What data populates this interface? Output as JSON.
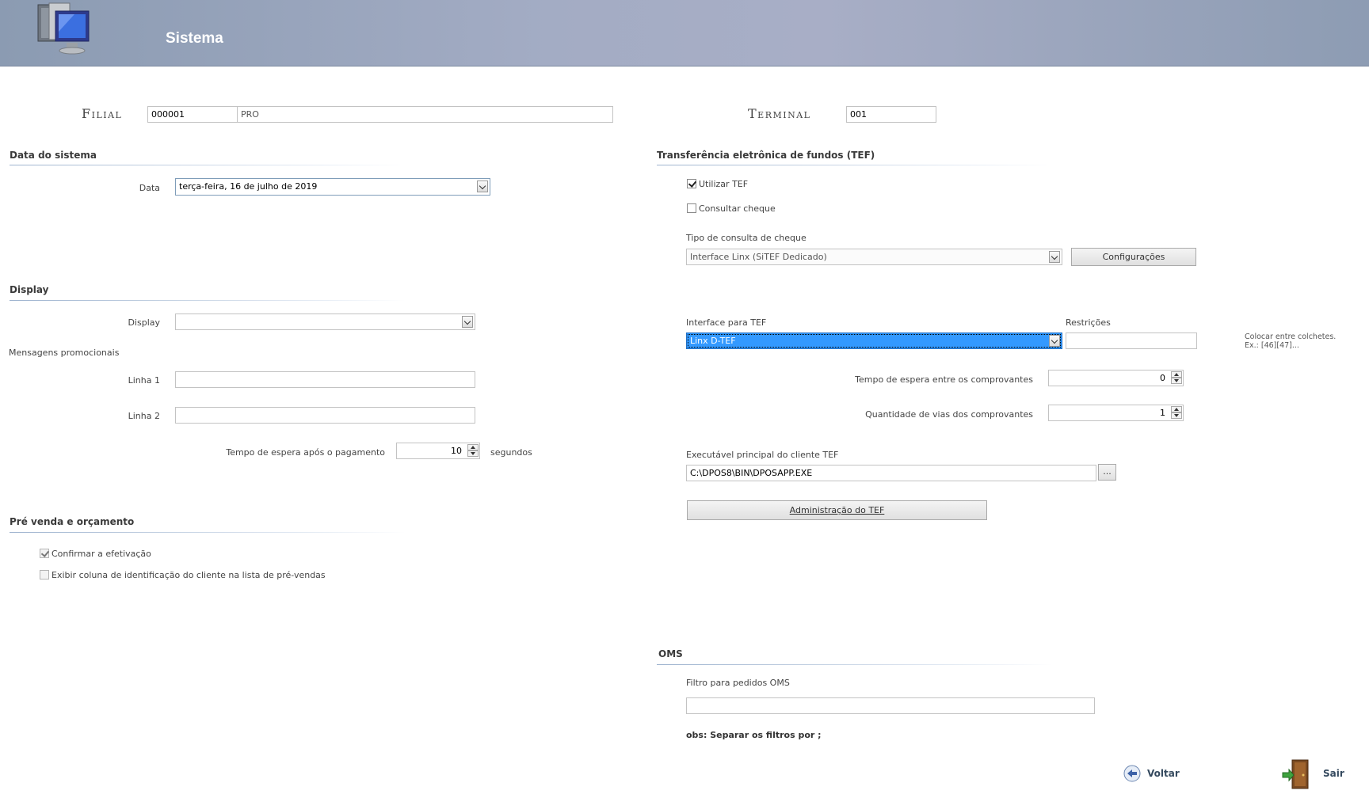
{
  "header": {
    "title": "Sistema",
    "logo_icon": "computer-safe-icon"
  },
  "filial": {
    "label": "Filial",
    "code": "000001",
    "name": "PRO"
  },
  "terminal": {
    "label": "Terminal",
    "value": "001"
  },
  "data_sistema": {
    "section": "Data do sistema",
    "data_label": "Data",
    "data_value": "terça-feira, 16 de julho de 2019"
  },
  "display": {
    "section": "Display",
    "display_label": "Display",
    "display_value": "",
    "mensagens_label": "Mensagens promocionais",
    "linha1_label": "Linha 1",
    "linha1_value": "",
    "linha2_label": "Linha 2",
    "linha2_value": "",
    "tempo_label": "Tempo de espera após o pagamento",
    "tempo_value": "10",
    "tempo_unit": "segundos"
  },
  "pre_venda": {
    "section": "Pré venda e orçamento",
    "confirmar_label": "Confirmar a efetivação",
    "confirmar_checked": true,
    "exibir_label": "Exibir coluna de identificação do cliente na lista de pré-vendas",
    "exibir_checked": false
  },
  "tef": {
    "section": "Transferência eletrônica de fundos (TEF)",
    "utilizar_label": "Utilizar TEF",
    "utilizar_checked": true,
    "consultar_label": "Consultar cheque",
    "consultar_checked": false,
    "tipo_label": "Tipo de consulta de cheque",
    "tipo_value": "Interface Linx (SiTEF Dedicado)",
    "config_button": "Configurações",
    "interface_label": "Interface para TEF",
    "interface_value": "Linx D-TEF",
    "restricoes_label": "Restrições",
    "restricoes_value": "",
    "restricoes_hint1": "Colocar entre colchetes.",
    "restricoes_hint2": "Ex.: [46][47]...",
    "tempo_label": "Tempo de espera entre os comprovantes",
    "tempo_value": "0",
    "vias_label": "Quantidade de vias dos comprovantes",
    "vias_value": "1",
    "exec_label": "Executável principal do cliente TEF",
    "exec_value": "C:\\DPOS8\\BIN\\DPOSAPP.EXE",
    "browse_button": "...",
    "admin_button": "Administração do TEF"
  },
  "oms": {
    "section": "OMS",
    "filtro_label": "Filtro para pedidos OMS",
    "filtro_value": "",
    "obs": "obs: Separar os filtros por ;"
  },
  "footer": {
    "voltar": "Voltar",
    "sair": "Sair"
  },
  "colors": {
    "header": "#a3acc4",
    "selection": "#3399ff",
    "section_line": "#9fb4cf"
  }
}
